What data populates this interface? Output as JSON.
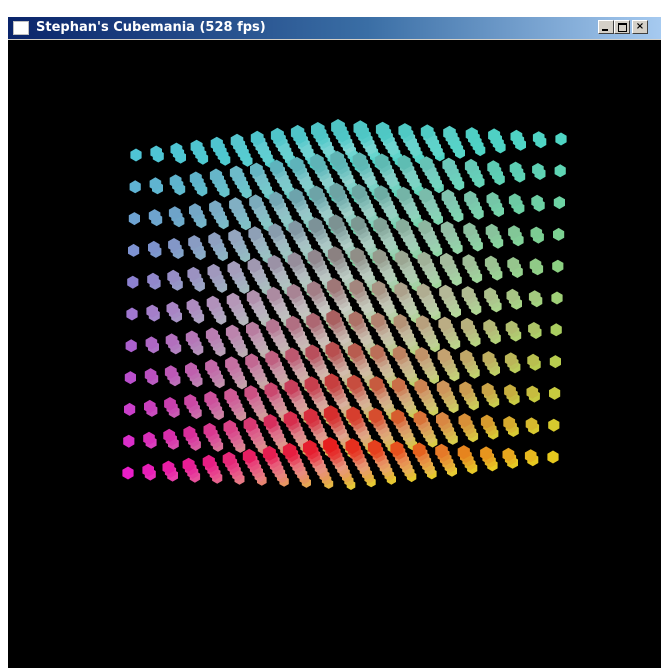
{
  "window": {
    "title": "Stephan's Cubemania (528 fps)",
    "controls": {
      "minimize": "",
      "maximize": "",
      "close": "×"
    }
  },
  "scene": {
    "background": "#000000",
    "grid_size": 11,
    "colors": {
      "top": "#3fd7d7",
      "left": "#e91ee6",
      "right": "#e6e61e",
      "bottom": "#e61e1e",
      "center": "#f2f2f2"
    }
  }
}
